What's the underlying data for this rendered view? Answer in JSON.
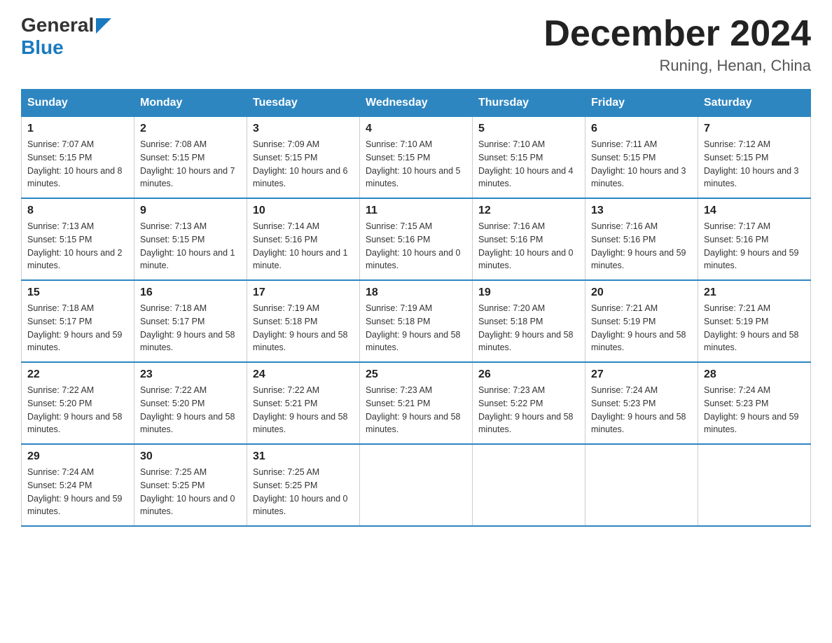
{
  "logo": {
    "general": "General",
    "blue": "Blue"
  },
  "title": {
    "month_year": "December 2024",
    "location": "Runing, Henan, China"
  },
  "weekdays": [
    "Sunday",
    "Monday",
    "Tuesday",
    "Wednesday",
    "Thursday",
    "Friday",
    "Saturday"
  ],
  "weeks": [
    [
      {
        "day": "1",
        "sunrise": "Sunrise: 7:07 AM",
        "sunset": "Sunset: 5:15 PM",
        "daylight": "Daylight: 10 hours and 8 minutes."
      },
      {
        "day": "2",
        "sunrise": "Sunrise: 7:08 AM",
        "sunset": "Sunset: 5:15 PM",
        "daylight": "Daylight: 10 hours and 7 minutes."
      },
      {
        "day": "3",
        "sunrise": "Sunrise: 7:09 AM",
        "sunset": "Sunset: 5:15 PM",
        "daylight": "Daylight: 10 hours and 6 minutes."
      },
      {
        "day": "4",
        "sunrise": "Sunrise: 7:10 AM",
        "sunset": "Sunset: 5:15 PM",
        "daylight": "Daylight: 10 hours and 5 minutes."
      },
      {
        "day": "5",
        "sunrise": "Sunrise: 7:10 AM",
        "sunset": "Sunset: 5:15 PM",
        "daylight": "Daylight: 10 hours and 4 minutes."
      },
      {
        "day": "6",
        "sunrise": "Sunrise: 7:11 AM",
        "sunset": "Sunset: 5:15 PM",
        "daylight": "Daylight: 10 hours and 3 minutes."
      },
      {
        "day": "7",
        "sunrise": "Sunrise: 7:12 AM",
        "sunset": "Sunset: 5:15 PM",
        "daylight": "Daylight: 10 hours and 3 minutes."
      }
    ],
    [
      {
        "day": "8",
        "sunrise": "Sunrise: 7:13 AM",
        "sunset": "Sunset: 5:15 PM",
        "daylight": "Daylight: 10 hours and 2 minutes."
      },
      {
        "day": "9",
        "sunrise": "Sunrise: 7:13 AM",
        "sunset": "Sunset: 5:15 PM",
        "daylight": "Daylight: 10 hours and 1 minute."
      },
      {
        "day": "10",
        "sunrise": "Sunrise: 7:14 AM",
        "sunset": "Sunset: 5:16 PM",
        "daylight": "Daylight: 10 hours and 1 minute."
      },
      {
        "day": "11",
        "sunrise": "Sunrise: 7:15 AM",
        "sunset": "Sunset: 5:16 PM",
        "daylight": "Daylight: 10 hours and 0 minutes."
      },
      {
        "day": "12",
        "sunrise": "Sunrise: 7:16 AM",
        "sunset": "Sunset: 5:16 PM",
        "daylight": "Daylight: 10 hours and 0 minutes."
      },
      {
        "day": "13",
        "sunrise": "Sunrise: 7:16 AM",
        "sunset": "Sunset: 5:16 PM",
        "daylight": "Daylight: 9 hours and 59 minutes."
      },
      {
        "day": "14",
        "sunrise": "Sunrise: 7:17 AM",
        "sunset": "Sunset: 5:16 PM",
        "daylight": "Daylight: 9 hours and 59 minutes."
      }
    ],
    [
      {
        "day": "15",
        "sunrise": "Sunrise: 7:18 AM",
        "sunset": "Sunset: 5:17 PM",
        "daylight": "Daylight: 9 hours and 59 minutes."
      },
      {
        "day": "16",
        "sunrise": "Sunrise: 7:18 AM",
        "sunset": "Sunset: 5:17 PM",
        "daylight": "Daylight: 9 hours and 58 minutes."
      },
      {
        "day": "17",
        "sunrise": "Sunrise: 7:19 AM",
        "sunset": "Sunset: 5:18 PM",
        "daylight": "Daylight: 9 hours and 58 minutes."
      },
      {
        "day": "18",
        "sunrise": "Sunrise: 7:19 AM",
        "sunset": "Sunset: 5:18 PM",
        "daylight": "Daylight: 9 hours and 58 minutes."
      },
      {
        "day": "19",
        "sunrise": "Sunrise: 7:20 AM",
        "sunset": "Sunset: 5:18 PM",
        "daylight": "Daylight: 9 hours and 58 minutes."
      },
      {
        "day": "20",
        "sunrise": "Sunrise: 7:21 AM",
        "sunset": "Sunset: 5:19 PM",
        "daylight": "Daylight: 9 hours and 58 minutes."
      },
      {
        "day": "21",
        "sunrise": "Sunrise: 7:21 AM",
        "sunset": "Sunset: 5:19 PM",
        "daylight": "Daylight: 9 hours and 58 minutes."
      }
    ],
    [
      {
        "day": "22",
        "sunrise": "Sunrise: 7:22 AM",
        "sunset": "Sunset: 5:20 PM",
        "daylight": "Daylight: 9 hours and 58 minutes."
      },
      {
        "day": "23",
        "sunrise": "Sunrise: 7:22 AM",
        "sunset": "Sunset: 5:20 PM",
        "daylight": "Daylight: 9 hours and 58 minutes."
      },
      {
        "day": "24",
        "sunrise": "Sunrise: 7:22 AM",
        "sunset": "Sunset: 5:21 PM",
        "daylight": "Daylight: 9 hours and 58 minutes."
      },
      {
        "day": "25",
        "sunrise": "Sunrise: 7:23 AM",
        "sunset": "Sunset: 5:21 PM",
        "daylight": "Daylight: 9 hours and 58 minutes."
      },
      {
        "day": "26",
        "sunrise": "Sunrise: 7:23 AM",
        "sunset": "Sunset: 5:22 PM",
        "daylight": "Daylight: 9 hours and 58 minutes."
      },
      {
        "day": "27",
        "sunrise": "Sunrise: 7:24 AM",
        "sunset": "Sunset: 5:23 PM",
        "daylight": "Daylight: 9 hours and 58 minutes."
      },
      {
        "day": "28",
        "sunrise": "Sunrise: 7:24 AM",
        "sunset": "Sunset: 5:23 PM",
        "daylight": "Daylight: 9 hours and 59 minutes."
      }
    ],
    [
      {
        "day": "29",
        "sunrise": "Sunrise: 7:24 AM",
        "sunset": "Sunset: 5:24 PM",
        "daylight": "Daylight: 9 hours and 59 minutes."
      },
      {
        "day": "30",
        "sunrise": "Sunrise: 7:25 AM",
        "sunset": "Sunset: 5:25 PM",
        "daylight": "Daylight: 10 hours and 0 minutes."
      },
      {
        "day": "31",
        "sunrise": "Sunrise: 7:25 AM",
        "sunset": "Sunset: 5:25 PM",
        "daylight": "Daylight: 10 hours and 0 minutes."
      },
      null,
      null,
      null,
      null
    ]
  ]
}
